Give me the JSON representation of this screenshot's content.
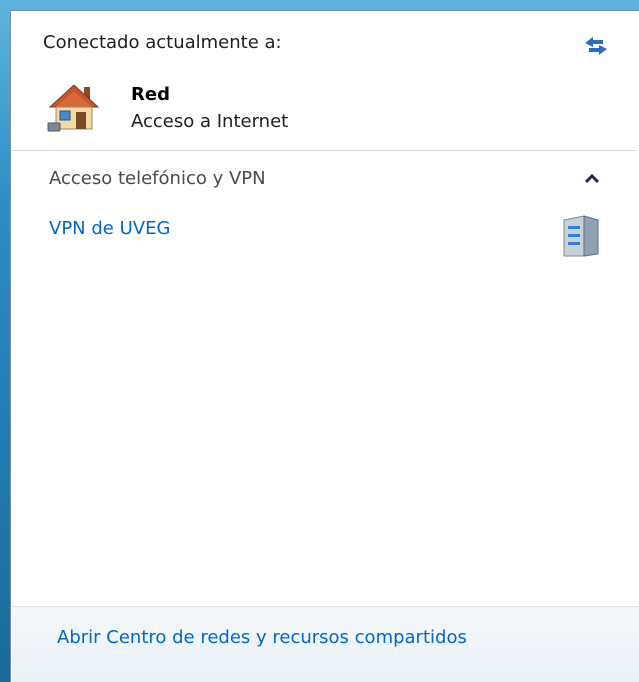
{
  "header": {
    "label": "Conectado actualmente a:",
    "refresh_icon": "refresh-arrows-icon"
  },
  "connection": {
    "name": "Red",
    "status": "Acceso a Internet",
    "icon": "home-network-icon"
  },
  "vpn_section": {
    "title": "Acceso telefónico y VPN",
    "collapse_icon": "chevron-up-icon",
    "items": [
      {
        "label": "VPN de UVEG",
        "icon": "vpn-server-icon"
      }
    ]
  },
  "footer": {
    "link": "Abrir Centro de redes y recursos compartidos"
  },
  "colors": {
    "link": "#0066cc",
    "footer_bg": "#eef4fa",
    "divider": "#d3d9e0"
  }
}
